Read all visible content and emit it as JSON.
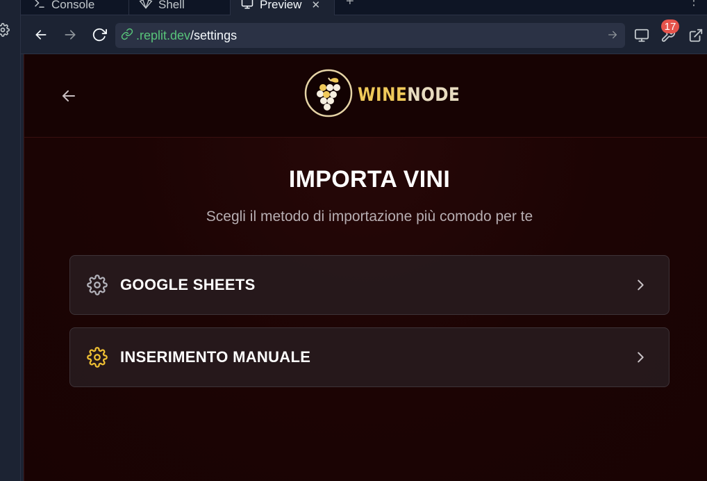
{
  "ide": {
    "tabs": [
      {
        "label": "Console",
        "icon": "terminal-icon"
      },
      {
        "label": "Shell",
        "icon": "shell-icon"
      },
      {
        "label": "Preview",
        "icon": "monitor-icon",
        "active": true
      }
    ],
    "add_tab": "+",
    "more": "⋮"
  },
  "urlbar": {
    "host": ".replit.dev",
    "path": "/settings",
    "notification_count": "17"
  },
  "app": {
    "logo": {
      "part1": "WINE",
      "part2": "NODE"
    },
    "title": "IMPORTA VINI",
    "subtitle": "Scegli il metodo di importazione più comodo per te",
    "options": [
      {
        "label": "GOOGLE SHEETS",
        "icon": "gear-icon",
        "icon_color": "#b3b3bb"
      },
      {
        "label": "INSERIMENTO MANUALE",
        "icon": "gear-icon",
        "icon_color": "#f0c033"
      }
    ]
  },
  "colors": {
    "accent_gold": "#f0c95a",
    "url_host": "#58c47a",
    "badge": "#e5534b",
    "app_bg": "#1c0404"
  }
}
